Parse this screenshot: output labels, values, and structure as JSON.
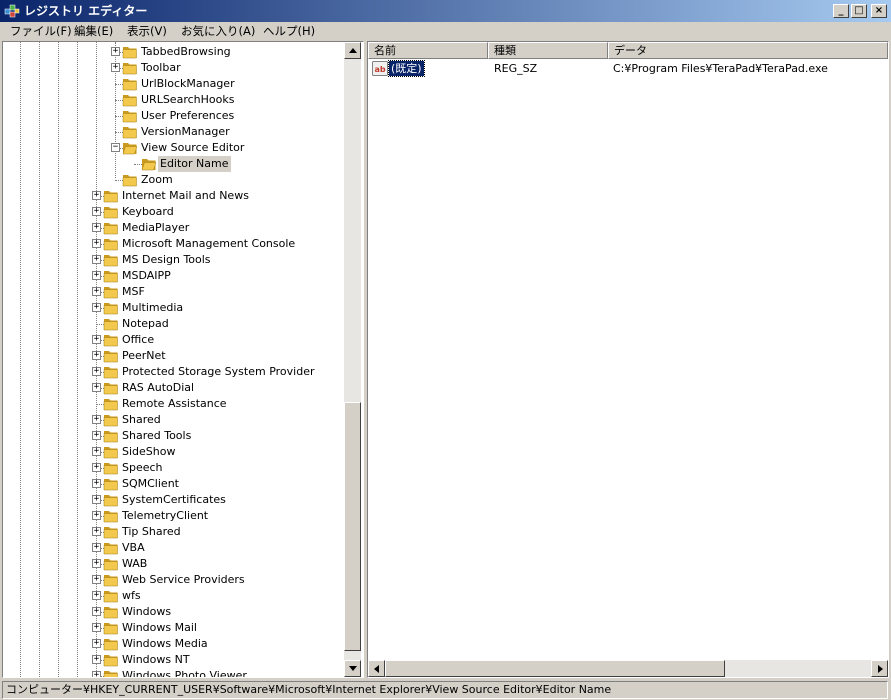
{
  "window": {
    "title": "レジストリ エディター",
    "colors": {
      "title_start": "#0a246a",
      "title_end": "#a6caf0",
      "folder": "#f2c94c"
    }
  },
  "title_buttons": {
    "minimize": "_",
    "maximize": "□",
    "close": "×"
  },
  "menu": [
    {
      "label": "ファイル(F)"
    },
    {
      "label": "編集(E)"
    },
    {
      "label": "表示(V)"
    },
    {
      "label": "お気に入り(A)"
    },
    {
      "label": "ヘルプ(H)"
    }
  ],
  "tree": [
    {
      "label": "TabbedBrowsing",
      "level": 2,
      "expander": "plus"
    },
    {
      "label": "Toolbar",
      "level": 2,
      "expander": "plus"
    },
    {
      "label": "UrlBlockManager",
      "level": 2,
      "expander": "none"
    },
    {
      "label": "URLSearchHooks",
      "level": 2,
      "expander": "none"
    },
    {
      "label": "User Preferences",
      "level": 2,
      "expander": "none"
    },
    {
      "label": "VersionManager",
      "level": 2,
      "expander": "none"
    },
    {
      "label": "View Source Editor",
      "level": 2,
      "expander": "minus",
      "open": true
    },
    {
      "label": "Editor Name",
      "level": 3,
      "expander": "none",
      "selected": true,
      "open": true
    },
    {
      "label": "Zoom",
      "level": 2,
      "expander": "none"
    },
    {
      "label": "Internet Mail and News",
      "level": 1,
      "expander": "plus"
    },
    {
      "label": "Keyboard",
      "level": 1,
      "expander": "plus"
    },
    {
      "label": "MediaPlayer",
      "level": 1,
      "expander": "plus"
    },
    {
      "label": "Microsoft Management Console",
      "level": 1,
      "expander": "plus"
    },
    {
      "label": "MS Design Tools",
      "level": 1,
      "expander": "plus"
    },
    {
      "label": "MSDAIPP",
      "level": 1,
      "expander": "plus"
    },
    {
      "label": "MSF",
      "level": 1,
      "expander": "plus"
    },
    {
      "label": "Multimedia",
      "level": 1,
      "expander": "plus"
    },
    {
      "label": "Notepad",
      "level": 1,
      "expander": "none"
    },
    {
      "label": "Office",
      "level": 1,
      "expander": "plus"
    },
    {
      "label": "PeerNet",
      "level": 1,
      "expander": "plus"
    },
    {
      "label": "Protected Storage System Provider",
      "level": 1,
      "expander": "plus"
    },
    {
      "label": "RAS AutoDial",
      "level": 1,
      "expander": "plus"
    },
    {
      "label": "Remote Assistance",
      "level": 1,
      "expander": "none"
    },
    {
      "label": "Shared",
      "level": 1,
      "expander": "plus"
    },
    {
      "label": "Shared Tools",
      "level": 1,
      "expander": "plus"
    },
    {
      "label": "SideShow",
      "level": 1,
      "expander": "plus"
    },
    {
      "label": "Speech",
      "level": 1,
      "expander": "plus"
    },
    {
      "label": "SQMClient",
      "level": 1,
      "expander": "plus"
    },
    {
      "label": "SystemCertificates",
      "level": 1,
      "expander": "plus"
    },
    {
      "label": "TelemetryClient",
      "level": 1,
      "expander": "plus"
    },
    {
      "label": "Tip Shared",
      "level": 1,
      "expander": "plus"
    },
    {
      "label": "VBA",
      "level": 1,
      "expander": "plus"
    },
    {
      "label": "WAB",
      "level": 1,
      "expander": "plus"
    },
    {
      "label": "Web Service Providers",
      "level": 1,
      "expander": "plus"
    },
    {
      "label": "wfs",
      "level": 1,
      "expander": "plus"
    },
    {
      "label": "Windows",
      "level": 1,
      "expander": "plus"
    },
    {
      "label": "Windows Mail",
      "level": 1,
      "expander": "plus"
    },
    {
      "label": "Windows Media",
      "level": 1,
      "expander": "plus"
    },
    {
      "label": "Windows NT",
      "level": 1,
      "expander": "plus"
    },
    {
      "label": "Windows Photo Viewer",
      "level": 1,
      "expander": "plus"
    }
  ],
  "list": {
    "columns": [
      {
        "label": "名前"
      },
      {
        "label": "種類"
      },
      {
        "label": "データ"
      }
    ],
    "rows": [
      {
        "icon": "ab",
        "name": "(既定)",
        "type": "REG_SZ",
        "data": "C:¥Program Files¥TeraPad¥TeraPad.exe",
        "selected": true
      }
    ]
  },
  "scroll": {
    "tree_thumb_start": 0.57,
    "tree_thumb_end": 0.985,
    "list_thumb_start": 0.0,
    "list_thumb_end": 0.7
  },
  "status": {
    "path": "コンピューター¥HKEY_CURRENT_USER¥Software¥Microsoft¥Internet Explorer¥View Source Editor¥Editor Name"
  }
}
